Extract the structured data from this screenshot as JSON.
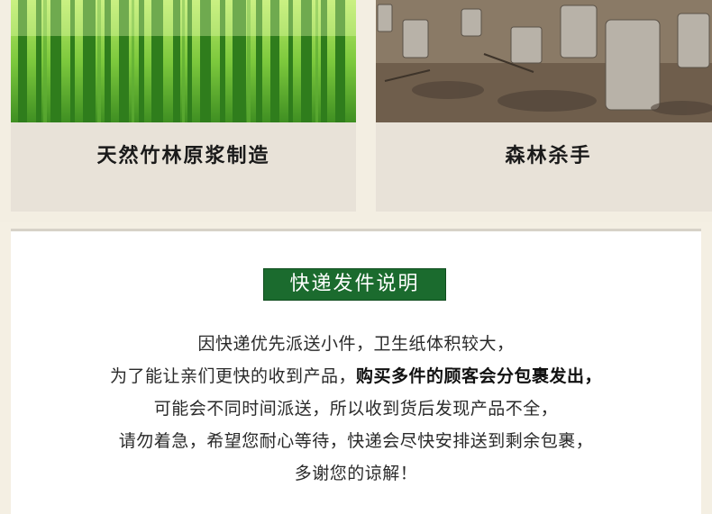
{
  "panels": [
    {
      "caption": "天然竹林原浆制造",
      "image": "bamboo-forest-photo"
    },
    {
      "caption": "森林杀手",
      "image": "tree-stumps-photo"
    }
  ],
  "notice": {
    "title": "快递发件说明",
    "lines": [
      "因快递优先派送小件，卫生纸体积较大，",
      "为了能让亲们更快的收到产品，",
      "可能会不同时间派送，所以收到货后发现产品不全，",
      "请勿着急，希望您耐心等待，快递会尽快安排送到剩余包裹，",
      "多谢您的谅解！"
    ],
    "line2_bold": "购买多件的顾客会分包裹发出，"
  },
  "colors": {
    "title_bg": "#1b6b2e",
    "page_bg": "#f4efe3",
    "bamboo_green": "#4aa82c"
  }
}
